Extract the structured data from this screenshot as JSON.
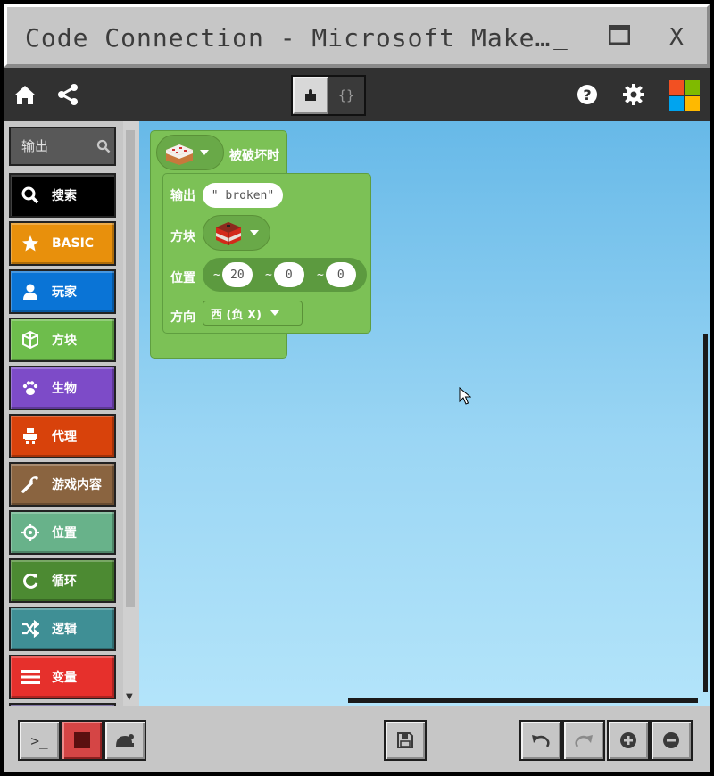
{
  "window": {
    "title": "Code Connection - Microsoft Make…",
    "minimize_glyph": "_",
    "close_glyph": "X"
  },
  "toolbar": {
    "icons": [
      "home-icon",
      "share-icon",
      "help-icon",
      "gear-icon"
    ],
    "view_toggle": {
      "active": "blocks",
      "code_label": "{}"
    }
  },
  "toolbox": {
    "search": {
      "placeholder": "输出"
    },
    "categories": [
      {
        "label": "搜索",
        "color": "#000000",
        "icon": "search-icon"
      },
      {
        "label": "BASIC",
        "color": "#e8900c",
        "icon": "star-icon"
      },
      {
        "label": "玩家",
        "color": "#0a74d6",
        "icon": "player-icon"
      },
      {
        "label": "方块",
        "color": "#6ebd4c",
        "icon": "cube-icon"
      },
      {
        "label": "生物",
        "color": "#7d4bc8",
        "icon": "paw-icon"
      },
      {
        "label": "代理",
        "color": "#d8420b",
        "icon": "agent-icon"
      },
      {
        "label": "游戏内容",
        "color": "#8a6440",
        "icon": "wrench-icon"
      },
      {
        "label": "位置",
        "color": "#68b28a",
        "icon": "crosshair-icon"
      },
      {
        "label": "循环",
        "color": "#4c8a32",
        "icon": "loop-icon"
      },
      {
        "label": "逻辑",
        "color": "#3f8f95",
        "icon": "shuffle-icon"
      },
      {
        "label": "变量",
        "color": "#e6302c",
        "icon": "variable-icon"
      }
    ]
  },
  "workspace": {
    "event_block": {
      "block_icon": "cake-block-icon",
      "label": "被破坏时"
    },
    "command_block": {
      "output_label": "输出",
      "output_string": "\" broken\"",
      "block_label": "方块",
      "block_icon": "tnt-block-icon",
      "position_label": "位置",
      "coords": [
        {
          "prefix": "~",
          "value": "20"
        },
        {
          "prefix": "~",
          "value": "0"
        },
        {
          "prefix": "~",
          "value": "0"
        }
      ],
      "direction_label": "方向",
      "direction_value": "西 (负 X)"
    }
  },
  "bottombar": {
    "console_glyph": ">_",
    "buttons": [
      "console-button",
      "stop-button",
      "turtle-button",
      "save-button",
      "undo-button",
      "redo-button",
      "zoom-in-button",
      "zoom-out-button"
    ]
  }
}
